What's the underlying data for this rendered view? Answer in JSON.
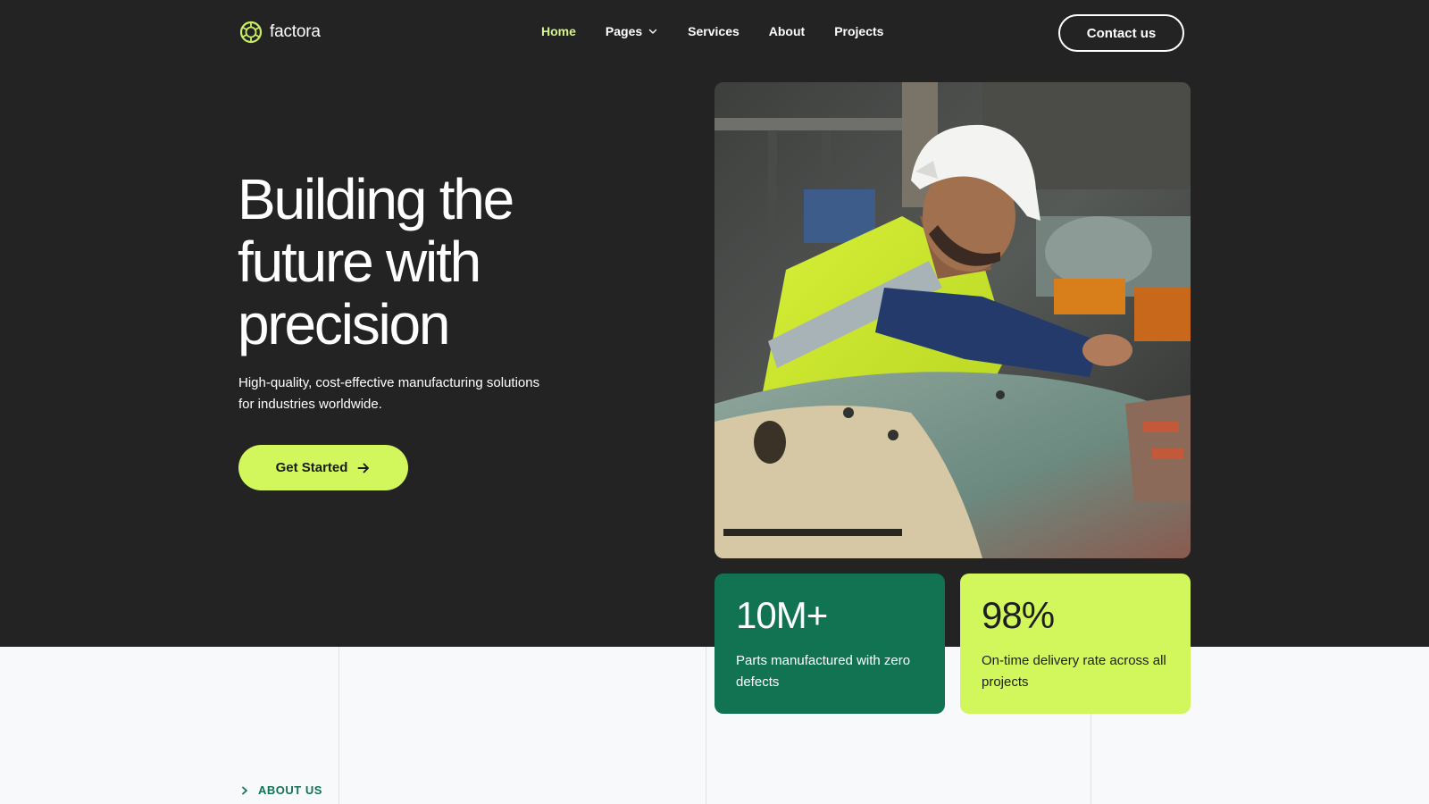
{
  "brand": {
    "name": "factora",
    "accent": "#d1f75d",
    "green": "#127353",
    "dark": "#232323"
  },
  "nav": {
    "items": [
      {
        "label": "Home",
        "active": true
      },
      {
        "label": "Pages",
        "has_dropdown": true
      },
      {
        "label": "Services"
      },
      {
        "label": "About"
      },
      {
        "label": "Projects"
      }
    ],
    "contact_label": "Contact us"
  },
  "hero": {
    "title": "Building the future with precision",
    "subtitle": "High-quality, cost-effective manufacturing solutions for industries worldwide.",
    "cta_label": "Get Started",
    "image_alt": "Worker in hard hat and high-visibility vest working on industrial machinery"
  },
  "stats": [
    {
      "value": "10M+",
      "description": "Parts manufactured with zero defects"
    },
    {
      "value": "98%",
      "description": "On-time delivery rate across all projects"
    }
  ],
  "about": {
    "label": "ABOUT US"
  },
  "icons": {
    "logo": "aperture-logo-icon",
    "dropdown": "chevron-down-icon",
    "cta": "arrow-right-icon",
    "about": "chevron-right-icon"
  }
}
